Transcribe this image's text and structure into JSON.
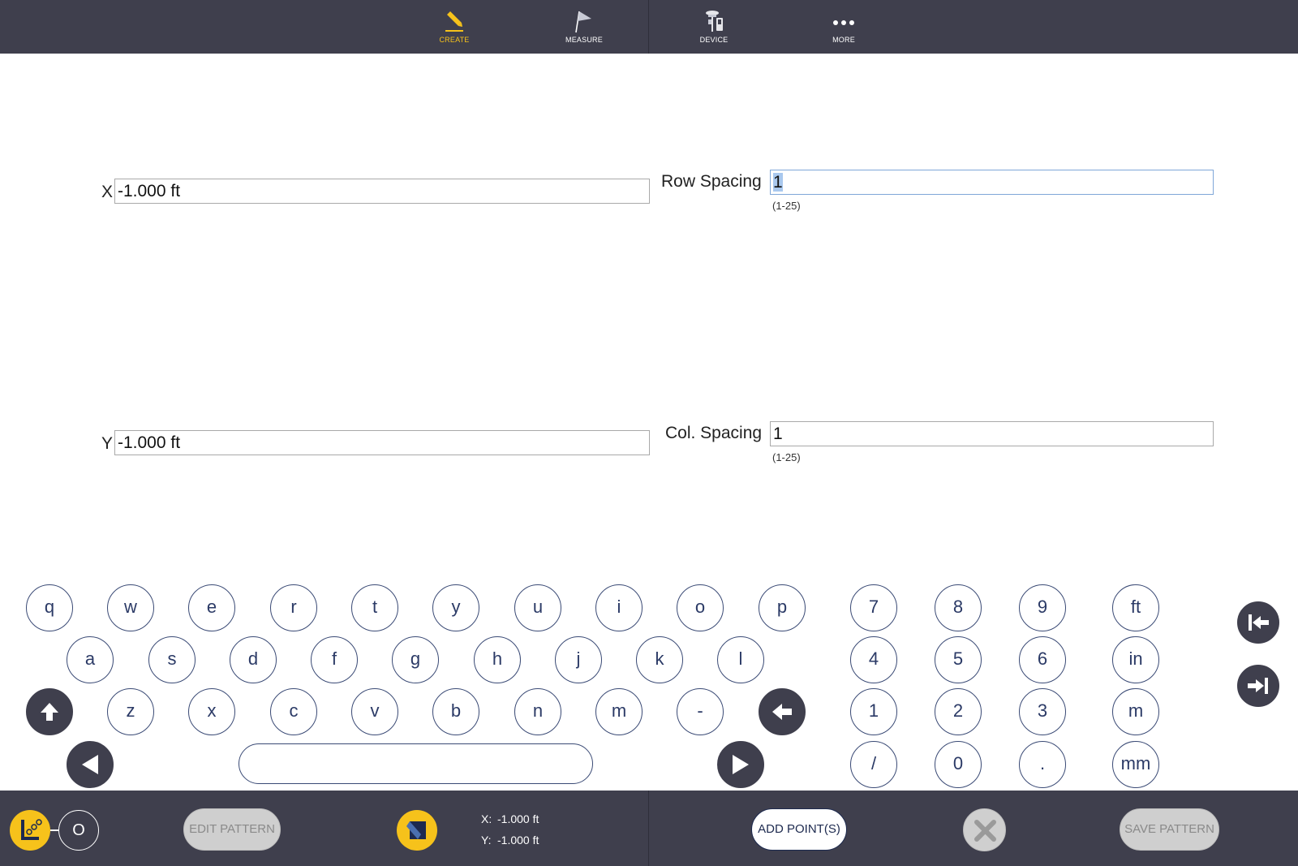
{
  "nav": {
    "items": [
      {
        "label": "CREATE",
        "icon": "pencil-icon",
        "active": true
      },
      {
        "label": "MEASURE",
        "icon": "flag-icon",
        "active": false
      },
      {
        "label": "DEVICE",
        "icon": "device-icon",
        "active": false
      },
      {
        "label": "MORE",
        "icon": "more-dots-icon",
        "active": false
      }
    ]
  },
  "form": {
    "x": {
      "label": "X",
      "value": "-1.000 ft"
    },
    "y": {
      "label": "Y",
      "value": "-1.000 ft"
    },
    "row_spacing": {
      "label": "Row Spacing",
      "value": "1",
      "hint": "(1-25)"
    },
    "col_spacing": {
      "label": "Col. Spacing",
      "value": "1",
      "hint": "(1-25)"
    }
  },
  "keyboard": {
    "row1": [
      "q",
      "w",
      "e",
      "r",
      "t",
      "y",
      "u",
      "i",
      "o",
      "p"
    ],
    "row2": [
      "a",
      "s",
      "d",
      "f",
      "g",
      "h",
      "j",
      "k",
      "l"
    ],
    "row3": [
      "z",
      "x",
      "c",
      "v",
      "b",
      "n",
      "m",
      "-"
    ],
    "numpad": [
      [
        "7",
        "8",
        "9",
        "ft"
      ],
      [
        "4",
        "5",
        "6",
        "in"
      ],
      [
        "1",
        "2",
        "3",
        "m"
      ],
      [
        "/",
        "0",
        ".",
        "mm"
      ]
    ]
  },
  "bottom": {
    "toggle_label": "O",
    "edit_pattern": "EDIT PATTERN",
    "add_points": "ADD POINT(S)",
    "save_pattern": "SAVE PATTERN",
    "coord_x_key": "X:",
    "coord_x_value": "-1.000 ft",
    "coord_y_key": "Y:",
    "coord_y_value": "-1.000 ft"
  },
  "colors": {
    "bar": "#3f3f4d",
    "accent": "#f6c21b",
    "key_border": "#3a4a75"
  }
}
